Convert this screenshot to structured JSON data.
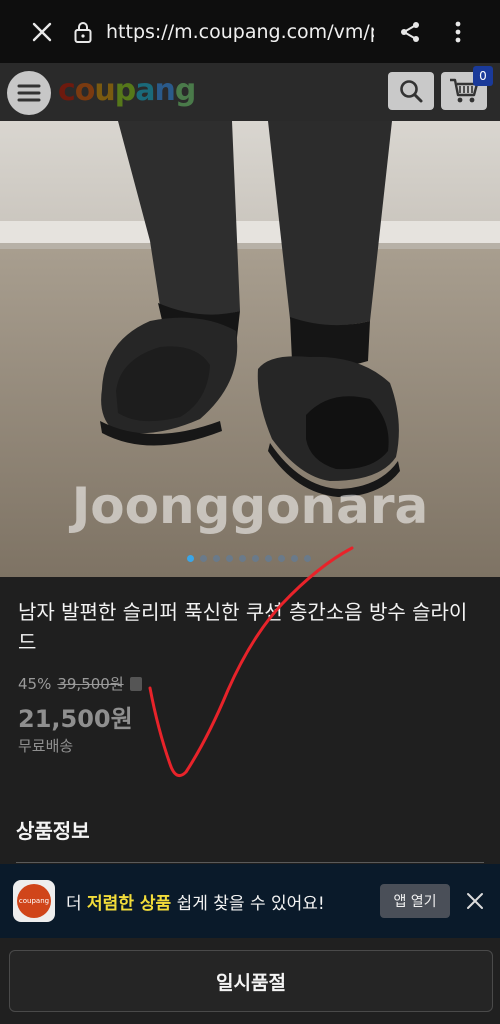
{
  "browser": {
    "url": "https://m.coupang.com/vm/p"
  },
  "header": {
    "logo_letters": [
      "c",
      "o",
      "u",
      "p",
      "a",
      "n",
      "g"
    ],
    "cart_count": "0"
  },
  "gallery": {
    "watermark": "Joonggonara",
    "dot_count": 10,
    "active_index": 0
  },
  "product": {
    "title": "남자 발편한 슬리퍼 푹신한 쿠션 층간소음 방수 슬라이드",
    "discount": "45%",
    "original_price": "39,500원",
    "price": "21,500원",
    "shipping": "무료배송"
  },
  "section": {
    "title": "상품정보"
  },
  "banner": {
    "logo_text": "coupang",
    "text_before": "더 ",
    "text_highlight": "저렴한 상품",
    "text_after": " 쉽게 찾을 수 있어요!",
    "open_button": "앱 열기"
  },
  "bottom": {
    "button_label": "일시품절"
  },
  "colors": {
    "highlight": "#f2dc3a",
    "dot_active": "#3aa6e8",
    "annotation": "#e8232a"
  }
}
